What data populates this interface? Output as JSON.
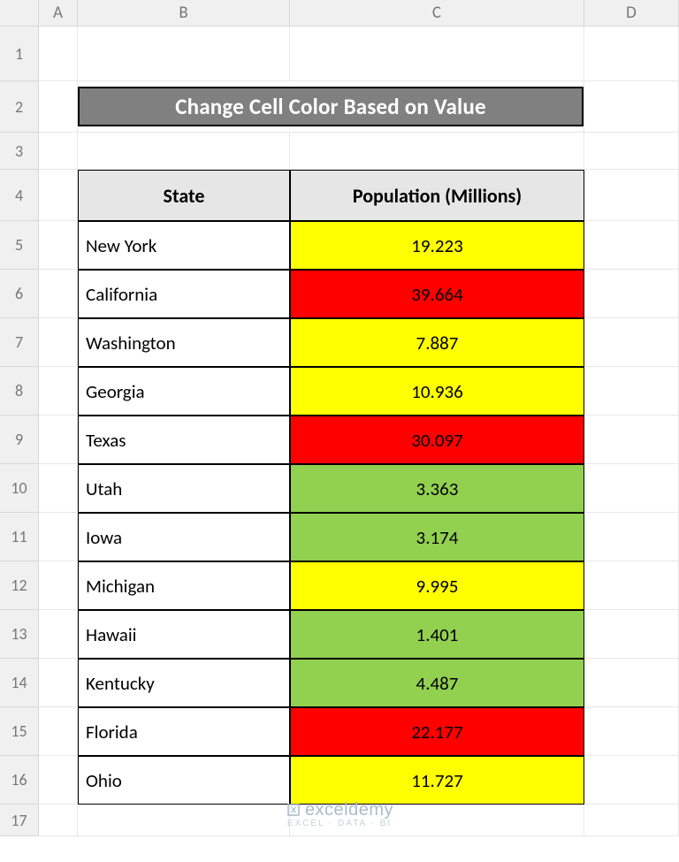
{
  "columns": [
    "A",
    "B",
    "C",
    "D"
  ],
  "rows": [
    "1",
    "2",
    "3",
    "4",
    "5",
    "6",
    "7",
    "8",
    "9",
    "10",
    "11",
    "12",
    "13",
    "14",
    "15",
    "16",
    "17"
  ],
  "title": "Change Cell Color Based on Value",
  "headers": {
    "state": "State",
    "population": "Population (Millions)"
  },
  "data": [
    {
      "state": "New York",
      "pop": "19.223",
      "color": "yellow"
    },
    {
      "state": "California",
      "pop": "39.664",
      "color": "red"
    },
    {
      "state": "Washington",
      "pop": "7.887",
      "color": "yellow"
    },
    {
      "state": "Georgia",
      "pop": "10.936",
      "color": "yellow"
    },
    {
      "state": "Texas",
      "pop": "30.097",
      "color": "red"
    },
    {
      "state": "Utah",
      "pop": "3.363",
      "color": "green"
    },
    {
      "state": "Iowa",
      "pop": "3.174",
      "color": "green"
    },
    {
      "state": "Michigan",
      "pop": "9.995",
      "color": "yellow"
    },
    {
      "state": "Hawaii",
      "pop": "1.401",
      "color": "green"
    },
    {
      "state": "Kentucky",
      "pop": "4.487",
      "color": "green"
    },
    {
      "state": "Florida",
      "pop": "22.177",
      "color": "red"
    },
    {
      "state": "Ohio",
      "pop": "11.727",
      "color": "yellow"
    }
  ],
  "watermark": {
    "brand": "exceldemy",
    "sub": "EXCEL · DATA · BI"
  }
}
